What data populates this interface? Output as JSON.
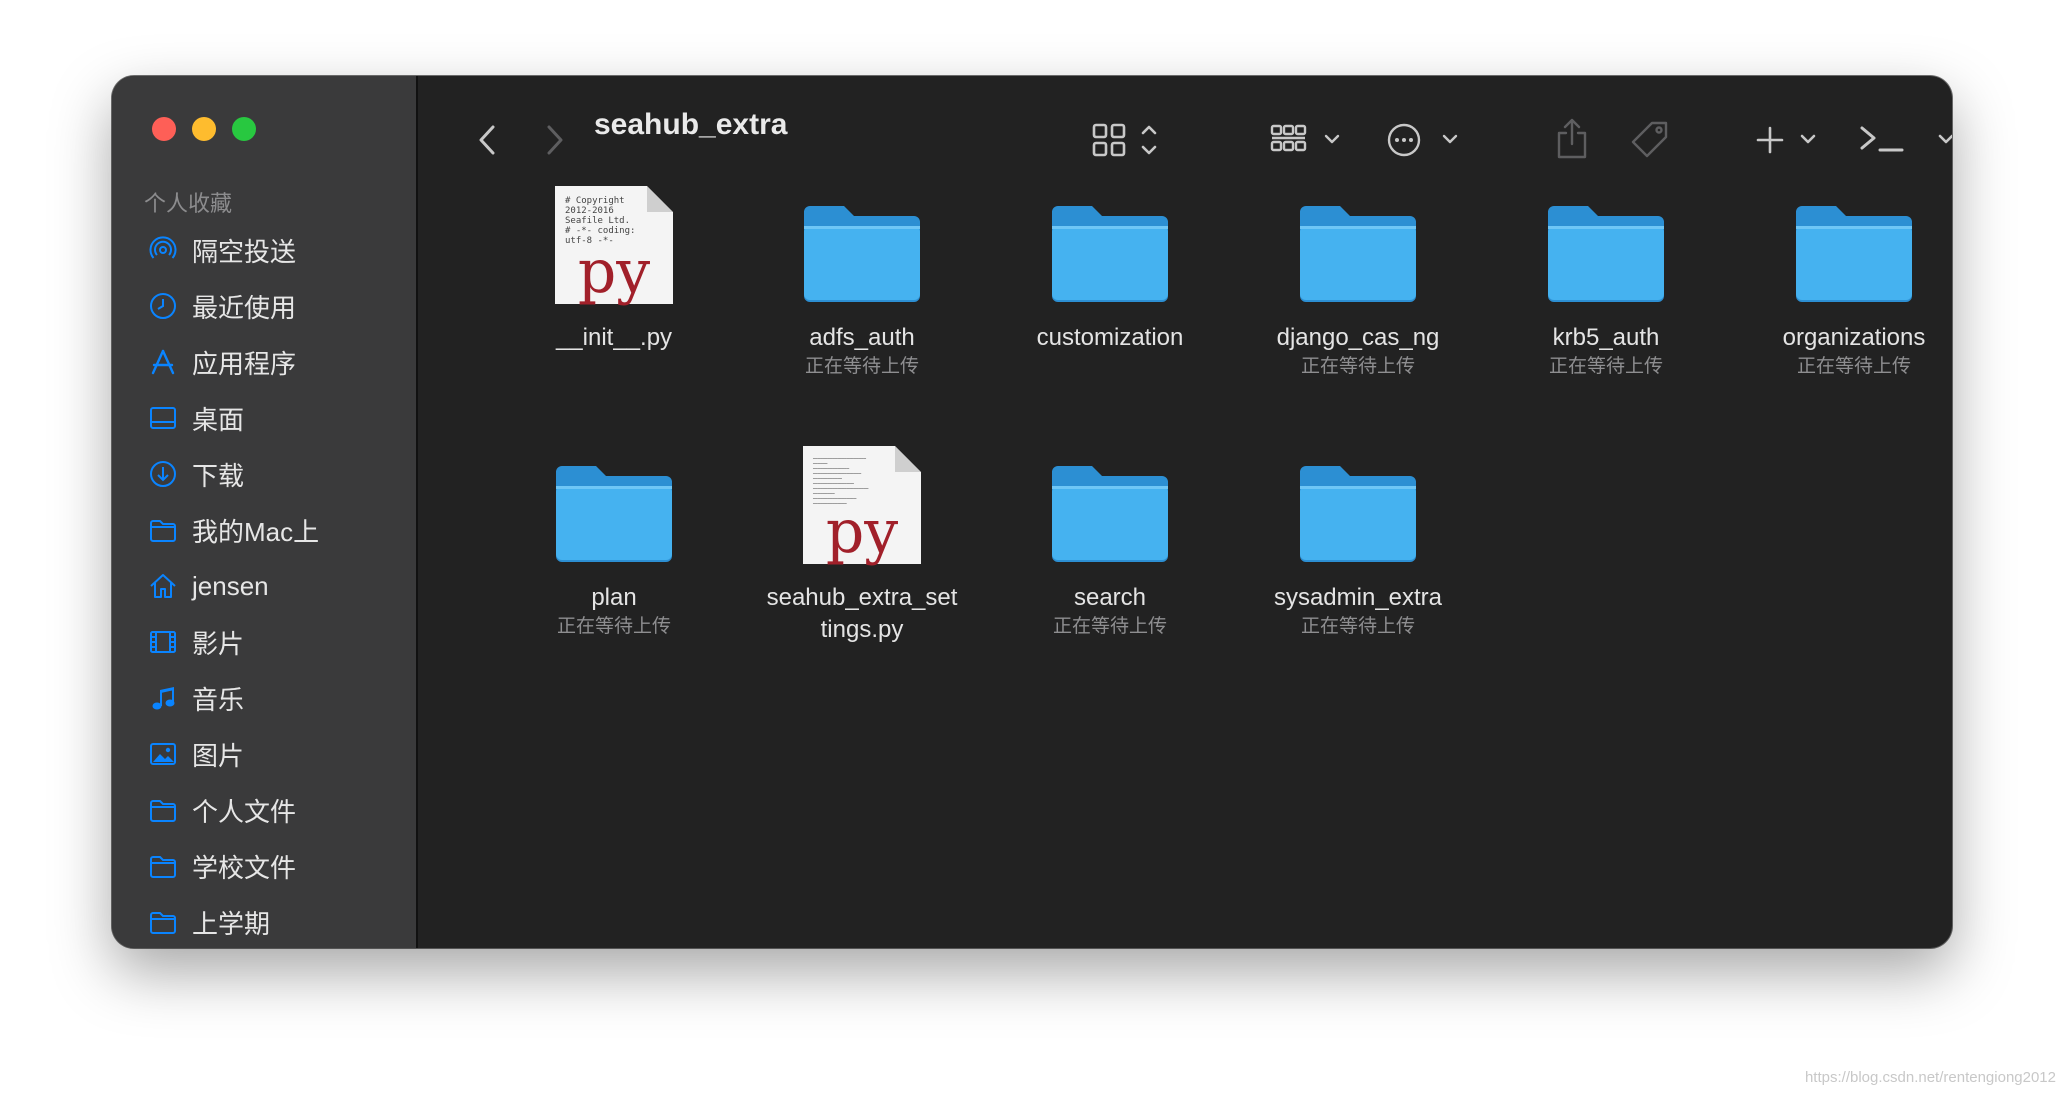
{
  "window": {
    "title": "seahub_extra"
  },
  "sidebar": {
    "section_title": "个人收藏",
    "items": [
      {
        "label": "隔空投送",
        "icon": "airdrop-icon"
      },
      {
        "label": "最近使用",
        "icon": "clock-icon"
      },
      {
        "label": "应用程序",
        "icon": "applications-icon"
      },
      {
        "label": "桌面",
        "icon": "desktop-icon"
      },
      {
        "label": "下载",
        "icon": "download-icon"
      },
      {
        "label": "我的Mac上",
        "icon": "folder-icon"
      },
      {
        "label": "jensen",
        "icon": "home-icon"
      },
      {
        "label": "影片",
        "icon": "film-icon"
      },
      {
        "label": "音乐",
        "icon": "music-icon"
      },
      {
        "label": "图片",
        "icon": "photo-icon"
      },
      {
        "label": "个人文件",
        "icon": "folder-icon"
      },
      {
        "label": "学校文件",
        "icon": "folder-icon"
      },
      {
        "label": "上学期",
        "icon": "folder-icon"
      }
    ]
  },
  "toolbar": {
    "back": "chevron-left-icon",
    "forward": "chevron-right-icon",
    "view_mode": "grid-view-icon",
    "group": "group-icon",
    "action": "ellipsis-circle-icon",
    "share": "share-icon",
    "tag": "tag-icon",
    "add": "plus-icon",
    "terminal": "terminal-icon",
    "search": "search-icon"
  },
  "files": [
    {
      "name": "__init__.py",
      "status": "",
      "kind": "py",
      "preview": "# Copyright\n2012-2016\nSeafile Ltd.\n# -*- coding:\nutf-8 -*-"
    },
    {
      "name": "adfs_auth",
      "status": "正在等待上传",
      "kind": "folder"
    },
    {
      "name": "customization",
      "status": "",
      "kind": "folder"
    },
    {
      "name": "django_cas_ng",
      "status": "正在等待上传",
      "kind": "folder"
    },
    {
      "name": "krb5_auth",
      "status": "正在等待上传",
      "kind": "folder"
    },
    {
      "name": "organizations",
      "status": "正在等待上传",
      "kind": "folder"
    },
    {
      "name": "plan",
      "status": "正在等待上传",
      "kind": "folder"
    },
    {
      "name": "seahub_extra_settings.py",
      "status": "",
      "kind": "py",
      "preview": ""
    },
    {
      "name": "search",
      "status": "正在等待上传",
      "kind": "folder"
    },
    {
      "name": "sysadmin_extra",
      "status": "正在等待上传",
      "kind": "folder"
    }
  ],
  "file_labels": {
    "f0_line1": "__init__.py",
    "f7_line1": "seahub_extra_set",
    "f7_line2": "tings.py"
  },
  "py_label": "py",
  "watermark": "https://blog.csdn.net/rentengiong2012",
  "colors": {
    "accent": "#0a84ff",
    "folder": "#45b2f0",
    "py_red": "#a1202a"
  }
}
